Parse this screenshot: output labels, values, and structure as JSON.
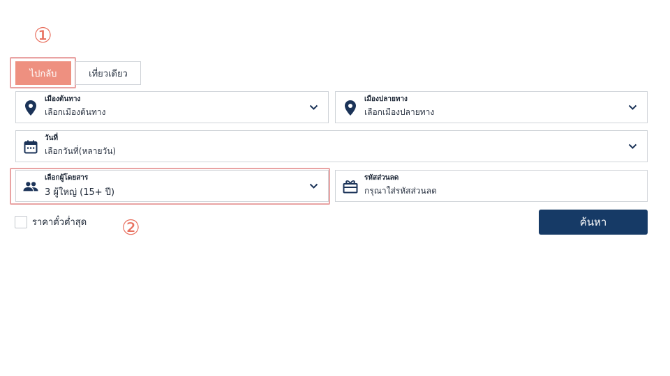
{
  "markers": {
    "one": "①",
    "two": "②"
  },
  "tabs": [
    {
      "label": "ไปกลับ",
      "active": true
    },
    {
      "label": "เที่ยวเดียว",
      "active": false
    }
  ],
  "origin": {
    "label": "เมืองต้นทาง",
    "value": "เลือกเมืองต้นทาง",
    "icon": "location-pin-icon"
  },
  "destination": {
    "label": "เมืองปลายทาง",
    "value": "เลือกเมืองปลายทาง",
    "icon": "location-pin-icon"
  },
  "date": {
    "label": "วันที่",
    "value": "เลือกวันที่(หลายวัน)",
    "icon": "calendar-icon"
  },
  "passengers": {
    "label": "เลือกผู้โดยสาร",
    "value": "3 ผู้ใหญ่ (15+ ปี)",
    "icon": "people-icon"
  },
  "promo": {
    "label": "รหัสส่วนลด",
    "placeholder": "กรุณาใส่รหัสส่วนลด",
    "icon": "gift-icon"
  },
  "lowest_fare": {
    "label": "ราคาตั๋วต่ำสุด",
    "checked": false
  },
  "search": {
    "label": "ค้นหา"
  },
  "colors": {
    "accent": "#ee9080",
    "highlight": "#e9a3a3",
    "primary": "#163a66",
    "marker": "#e8705f"
  }
}
